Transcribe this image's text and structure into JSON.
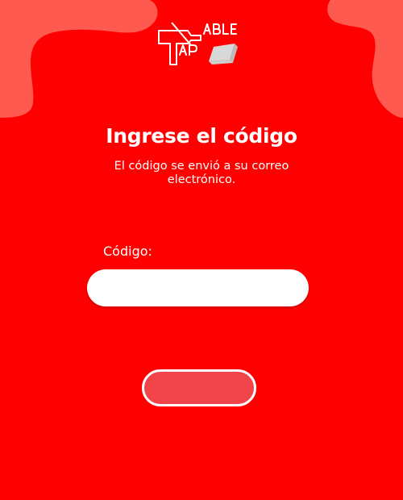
{
  "brand": {
    "logo_text": "TABLE TAP"
  },
  "header": {
    "title": "Ingrese el código",
    "subtitle": "El código se envió a su correo electrónico."
  },
  "form": {
    "code_label": "Código:",
    "code_value": "",
    "submit_label": ""
  },
  "colors": {
    "background": "#ff0000",
    "blob": "#ff5a50",
    "button_fill": "#f0434a",
    "text": "#ffffff",
    "input_fill": "#ffffff"
  },
  "icons": [
    "logo-t-icon",
    "logo-tile-icon"
  ]
}
